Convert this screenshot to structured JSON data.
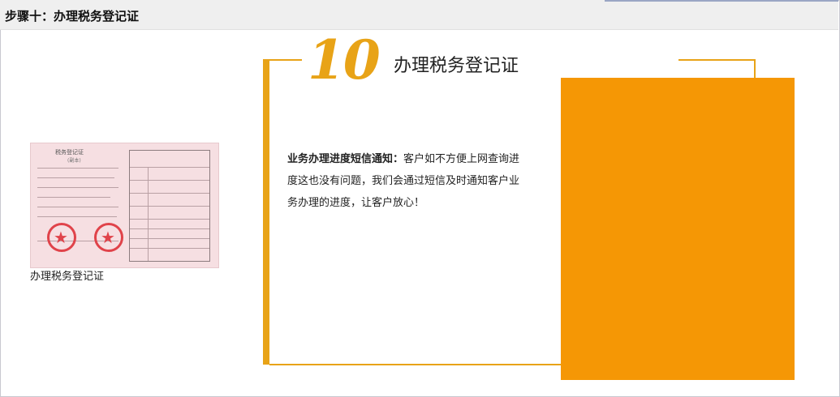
{
  "header": {
    "step_title": "步骤十：办理税务登记证"
  },
  "certificate": {
    "doc_title": "税务登记证",
    "doc_subtitle": "(副本)",
    "caption": "办理税务登记证"
  },
  "section": {
    "number": "10",
    "title": "办理税务登记证",
    "lead": "业务办理进度短信通知：",
    "body": "客户如不方便上网查询进度这也没有问题，我们会通过短信及时通知客户业务办理的进度，让客户放心！"
  },
  "colors": {
    "accent": "#e8a317",
    "panel": "#f59705"
  }
}
